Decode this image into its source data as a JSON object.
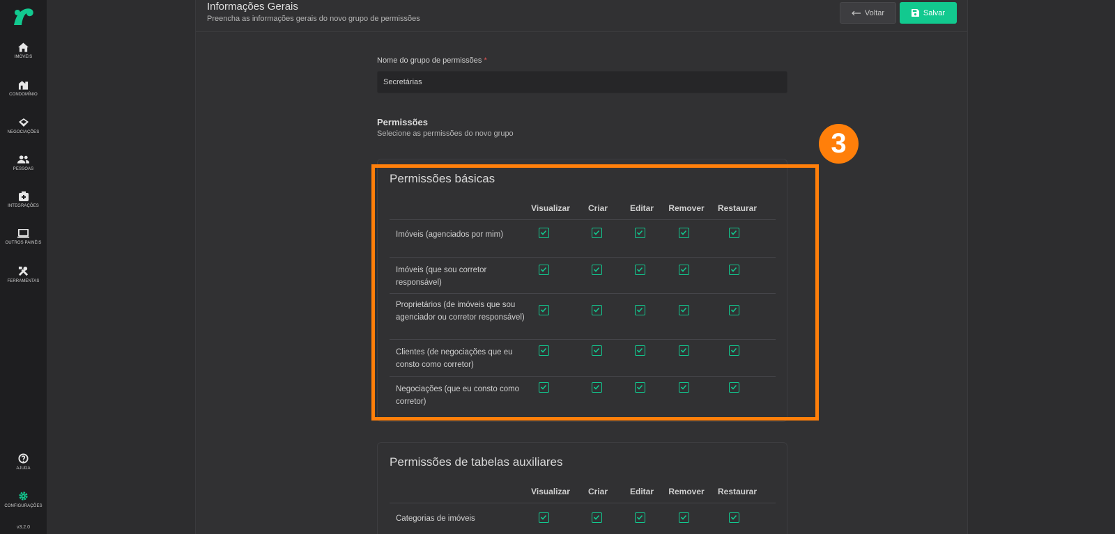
{
  "app": {
    "version": "v3.2.0",
    "brand_color": "#12c98f"
  },
  "sidebar": {
    "items": [
      {
        "label": "IMÓVEIS",
        "icon": "home-icon"
      },
      {
        "label": "CONDOMÍNIO",
        "icon": "building-icon"
      },
      {
        "label": "NEGOCIAÇÕES",
        "icon": "handshake-icon"
      },
      {
        "label": "PESSOAS",
        "icon": "people-icon"
      },
      {
        "label": "INTEGRAÇÕES",
        "icon": "plug-icon"
      },
      {
        "label": "OUTROS PAINÉIS",
        "icon": "laptop-icon"
      },
      {
        "label": "FERRAMENTAS",
        "icon": "tools-icon"
      }
    ],
    "bottom_items": [
      {
        "label": "AJUDA",
        "icon": "help-icon"
      },
      {
        "label": "CONFIGURAÇÕES",
        "icon": "gear-icon"
      }
    ]
  },
  "header": {
    "title": "Informações Gerais",
    "subtitle": "Preencha as informações gerais do novo grupo de permissões",
    "back_label": "Voltar",
    "save_label": "Salvar"
  },
  "form": {
    "group_name_label": "Nome do grupo de permissões",
    "required_mark": "*",
    "group_name_value": "Secretárias",
    "permissions_title": "Permissões",
    "permissions_subtitle": "Selecione as permissões do novo grupo"
  },
  "columns": [
    "Visualizar",
    "Criar",
    "Editar",
    "Remover",
    "Restaurar"
  ],
  "basic": {
    "title": "Permissões básicas",
    "rows": [
      {
        "label": "Imóveis (agenciados por mim)",
        "checked": [
          true,
          true,
          true,
          true,
          true
        ]
      },
      {
        "label": "Imóveis (que sou corretor responsável)",
        "checked": [
          true,
          true,
          true,
          true,
          true
        ]
      },
      {
        "label": "Proprietários (de imóveis que sou agenciador ou corretor responsável)",
        "checked": [
          true,
          true,
          true,
          true,
          true
        ]
      },
      {
        "label": "Clientes (de negociações que eu consto como corretor)",
        "checked": [
          true,
          true,
          true,
          true,
          true
        ]
      },
      {
        "label": "Negociações (que eu consto como corretor)",
        "checked": [
          true,
          true,
          true,
          true,
          true
        ]
      }
    ]
  },
  "auxiliary": {
    "title": "Permissões de tabelas auxiliares",
    "rows": [
      {
        "label": "Categorias de imóveis",
        "checked": [
          true,
          true,
          true,
          true,
          true
        ]
      }
    ]
  },
  "annotation": {
    "step": "3",
    "color": "#ff7f0a"
  }
}
